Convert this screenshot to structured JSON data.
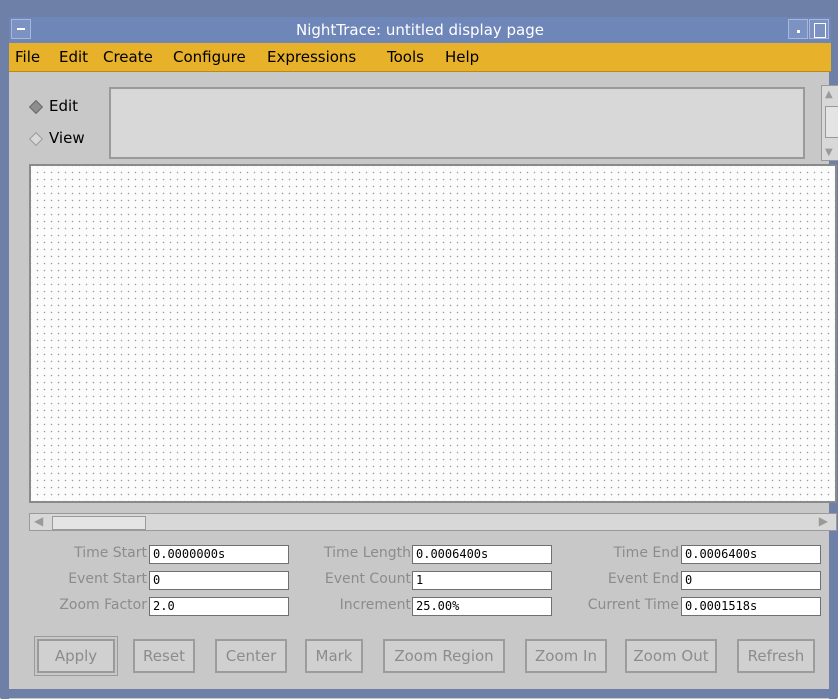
{
  "window": {
    "title": "NightTrace: untitled display page"
  },
  "menubar": {
    "items": [
      "File",
      "Edit",
      "Create",
      "Configure",
      "Expressions",
      "Tools",
      "Help"
    ]
  },
  "mode": {
    "options": [
      {
        "label": "Edit",
        "selected": true
      },
      {
        "label": "View",
        "selected": false
      }
    ]
  },
  "fields": {
    "time_start": {
      "label": "Time Start",
      "value": "0.0000000s"
    },
    "time_length": {
      "label": "Time Length",
      "value": "0.0006400s"
    },
    "time_end": {
      "label": "Time End",
      "value": "0.0006400s"
    },
    "event_start": {
      "label": "Event Start",
      "value": "0"
    },
    "event_count": {
      "label": "Event Count",
      "value": "1"
    },
    "event_end": {
      "label": "Event End",
      "value": "0"
    },
    "zoom_factor": {
      "label": "Zoom Factor",
      "value": "2.0"
    },
    "increment": {
      "label": "Increment",
      "value": "25.00%"
    },
    "current_time": {
      "label": "Current Time",
      "value": "0.0001518s"
    }
  },
  "buttons": {
    "apply": "Apply",
    "reset": "Reset",
    "center": "Center",
    "mark": "Mark",
    "zoom_region": "Zoom Region",
    "zoom_in": "Zoom In",
    "zoom_out": "Zoom Out",
    "refresh": "Refresh"
  },
  "icons": {
    "window_menu": "minus-icon",
    "iconify": "dot-icon",
    "maximize": "square-icon",
    "scroll_up": "triangle-up-icon",
    "scroll_down": "triangle-down-icon",
    "scroll_left": "triangle-left-icon",
    "scroll_right": "triangle-right-icon"
  },
  "colors": {
    "titlebar": "#6f86b8",
    "menubar": "#e7b12a",
    "background": "#c8c8c8"
  }
}
